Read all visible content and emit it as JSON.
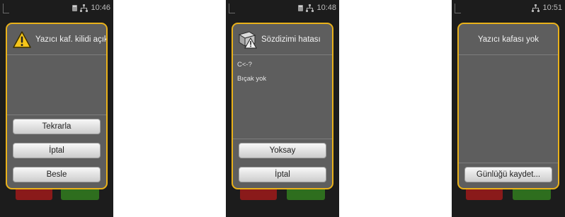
{
  "screens": [
    {
      "time": "10:46",
      "title": "Yazıcı kaf. kilidi açık",
      "body": [],
      "buttons": [
        "Tekrarla",
        "İptal",
        "Besle"
      ]
    },
    {
      "time": "10:48",
      "title": "Sözdizimi hatası",
      "body": [
        "C<-?",
        "Bıçak yok"
      ],
      "buttons": [
        "Yoksay",
        "İptal"
      ]
    },
    {
      "time": "10:51",
      "title": "Yazıcı kafası yok",
      "body": [],
      "buttons": [
        "Günlüğü kaydet..."
      ]
    }
  ],
  "icons": {
    "warning": "warning-icon",
    "syntax_error": "printer-error-icon",
    "sd_card": "sd-card-icon",
    "network": "network-icon"
  },
  "colors": {
    "dialog_border": "#e9b11a",
    "dialog_bg": "#5e5e5e",
    "screen_bg": "#1c1c1c",
    "bg_button_red": "#8a1a1a",
    "bg_button_green": "#2e6e1e"
  }
}
